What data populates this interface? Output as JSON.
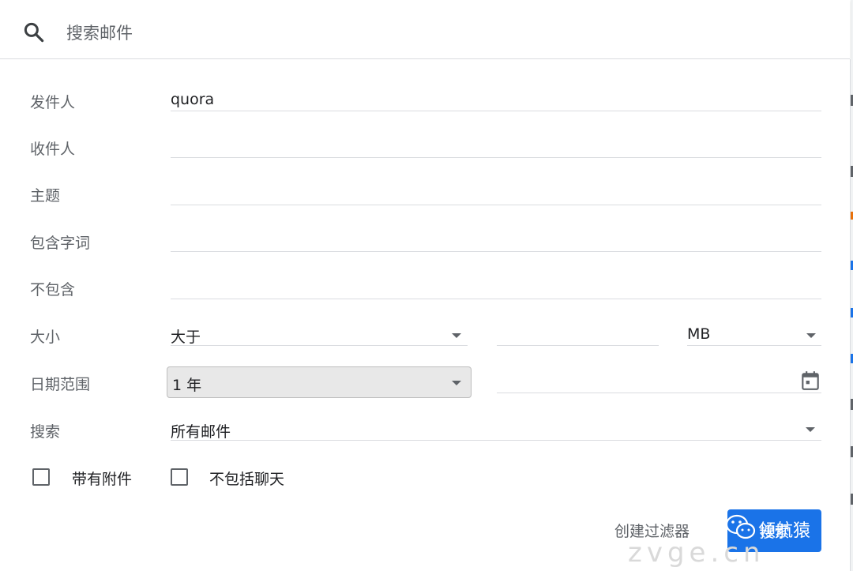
{
  "search": {
    "placeholder": "搜索邮件",
    "icon": "search-icon"
  },
  "form": {
    "from": {
      "label": "发件人",
      "value": "quora"
    },
    "to": {
      "label": "收件人",
      "value": ""
    },
    "subject": {
      "label": "主题",
      "value": ""
    },
    "has_words": {
      "label": "包含字词",
      "value": ""
    },
    "not_has": {
      "label": "不包含",
      "value": ""
    },
    "size": {
      "label": "大小",
      "comparator": "大于",
      "amount": "",
      "unit": "MB"
    },
    "date_range": {
      "label": "日期范围",
      "value": "1 年",
      "date": "",
      "icon": "calendar-icon"
    },
    "search_in": {
      "label": "搜索",
      "value": "所有邮件"
    },
    "has_attachment": {
      "label": "带有附件",
      "checked": false
    },
    "exclude_chats": {
      "label": "不包括聊天",
      "checked": false
    }
  },
  "actions": {
    "create_filter": "创建过滤器",
    "search": "搜索"
  },
  "watermark": {
    "text": "领航猿",
    "url": "zvge.cn",
    "icon": "wechat-icon"
  },
  "colors": {
    "accent": "#1a73e8",
    "label": "#5f6368",
    "text": "#202124",
    "divider": "#dadce0"
  }
}
